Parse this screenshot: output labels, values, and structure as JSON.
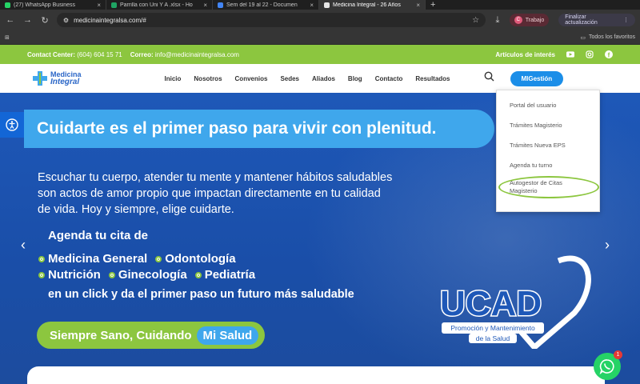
{
  "browser": {
    "tabs": [
      {
        "label": "(27) WhatsApp Business",
        "color": "#25d366"
      },
      {
        "label": "Parrilla con Uni Y A .xlsx - Ho",
        "color": "#1fa463"
      },
      {
        "label": "Sem del 19 al 22 - Documen",
        "color": "#4285f4"
      },
      {
        "label": "Medicina Integral - 26 Años",
        "color": "#e6e6e6",
        "active": true
      }
    ],
    "new_tab": "+",
    "url": "medicinaintegralsa.com/#",
    "profile": {
      "initial": "C",
      "label": "Trabajo"
    },
    "update_button": "Finalizar actualización",
    "all_bookmarks": "Todos los favoritos"
  },
  "topbar": {
    "contact_label": "Contact Center:",
    "contact_value": "(604) 604 15 71",
    "email_label": "Correo:",
    "email_value": "info@medicinaintegralsa.com",
    "articles": "Artículos de interés"
  },
  "nav": {
    "logo_line1": "Medicina",
    "logo_line2": "Integral",
    "items": [
      "Inicio",
      "Nosotros",
      "Convenios",
      "Sedes",
      "Aliados",
      "Blog",
      "Contacto",
      "Resultados"
    ],
    "cta": "MIGestión"
  },
  "dropdown": {
    "items": [
      "Portal del usuario",
      "Trámites Magisterio",
      "Trámites Nueva EPS",
      "Agenda tu turno"
    ],
    "highlighted_line1": "Autogestor de Citas",
    "highlighted_line2": "Magisterio"
  },
  "hero": {
    "headline": "Cuidarte es el primer paso para vivir con plenitud.",
    "paragraph_1": "Escuchar tu cuerpo, atender tu mente y mantener hábitos saludables",
    "paragraph_2": "son actos de amor propio que impactan directamente en tu calidad",
    "paragraph_3": "de vida. Hoy y siempre, elige cuidarte.",
    "agenda": "Agenda tu cita de",
    "services_row1": [
      "Medicina General",
      "Odontología"
    ],
    "services_row2": [
      "Nutrición",
      "Ginecología",
      "Pediatría"
    ],
    "click_line": "en un click  y da el primer paso un futuro más saludable",
    "slogan": "Siempre Sano, Cuidando",
    "slogan_highlight": "Mi Salud",
    "ucad_title": "UCAD",
    "ucad_sub1": "Promoción y Mantenimiento",
    "ucad_sub2": "de la Salud"
  },
  "whatsapp": {
    "badge": "1"
  },
  "colors": {
    "green": "#8cc63f",
    "blue": "#1e58b8",
    "light_blue": "#3fa7ec",
    "cta_blue": "#1b8ee8"
  }
}
